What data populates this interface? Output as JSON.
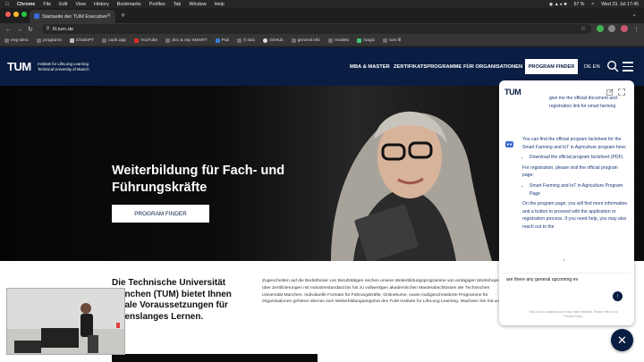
{
  "menubar": {
    "apple": "",
    "items": [
      "Chrome",
      "File",
      "Edit",
      "View",
      "History",
      "Bookmarks",
      "Profiles",
      "Tab",
      "Window",
      "Help"
    ],
    "battery": "67 %",
    "datetime": "Wed 23. Jul  17:45"
  },
  "browser": {
    "tab_title": "Startseite der TUM Executive",
    "url": "lll.tum.de",
    "bookmarks": [
      "eng-desc",
      "programs",
      "ChatGPT",
      "cash.app",
      "YouTube",
      "doc & rep SMART",
      "Pub",
      "§ stac",
      "GitHub",
      "general info",
      "modelo",
      "magic",
      "tum lll"
    ]
  },
  "site": {
    "logo": "TUM",
    "logo_line1": "Institute for LifeLong Learning",
    "logo_line2": "Technical University of Munich",
    "nav": [
      "MBA & MASTER",
      "ZERTIFIKATSPROGRAMME",
      "FÜR ORGANISATIONEN"
    ],
    "nav_cta": "PROGRAM FINDER",
    "lang": "DE EN",
    "hero_title": "Weiterbildung für Fach- und Führungskräfte",
    "hero_button": "PROGRAM FINDER",
    "intro_heading": "Die Technische Universität München (TUM) bietet Ihnen ideale Voraussetzungen für lebenslanges Lernen.",
    "intro_text": "Zugeschnitten auf die Bedürfnisse von Berufstätigen reichen unsere Weiterbildungsprogramme von eintägigen Workshops über Zertifizierungen mit Industriestandard bis hin zu vollwertigen akademischen Masterabschlüssen der Technischen Universität München. Individuelle Formate für Führungskräfte, Onlinekurse, sowie maßgeschneiderte Programme für Organisationen gehören ebenso zum Weiterbildungsangebot des TUM Institute for LifeLong Learning. Wachsen Sie mit uns!"
  },
  "chat": {
    "logo": "TUM",
    "user_message": "give me the official document and registration link for smart farming",
    "bot_intro": "You can find the official program factsheet for the Smart Farming and IoT in Agriculture program here:",
    "bot_link1": "Download the official program factsheet (PDF)",
    "bot_register": "For registration, please visit the official program page:",
    "bot_link2": "Smart Farming and IoT in Agriculture Program Page",
    "bot_outro": "On the program page, you will find more information and a button to proceed with the application or registration process. If you need help, you may also reach out to the",
    "input_value": "are there any general upcoming ev",
    "legal": "This is an AI assistant and it may make mistakes. Please refer to our Privacy Policy."
  }
}
